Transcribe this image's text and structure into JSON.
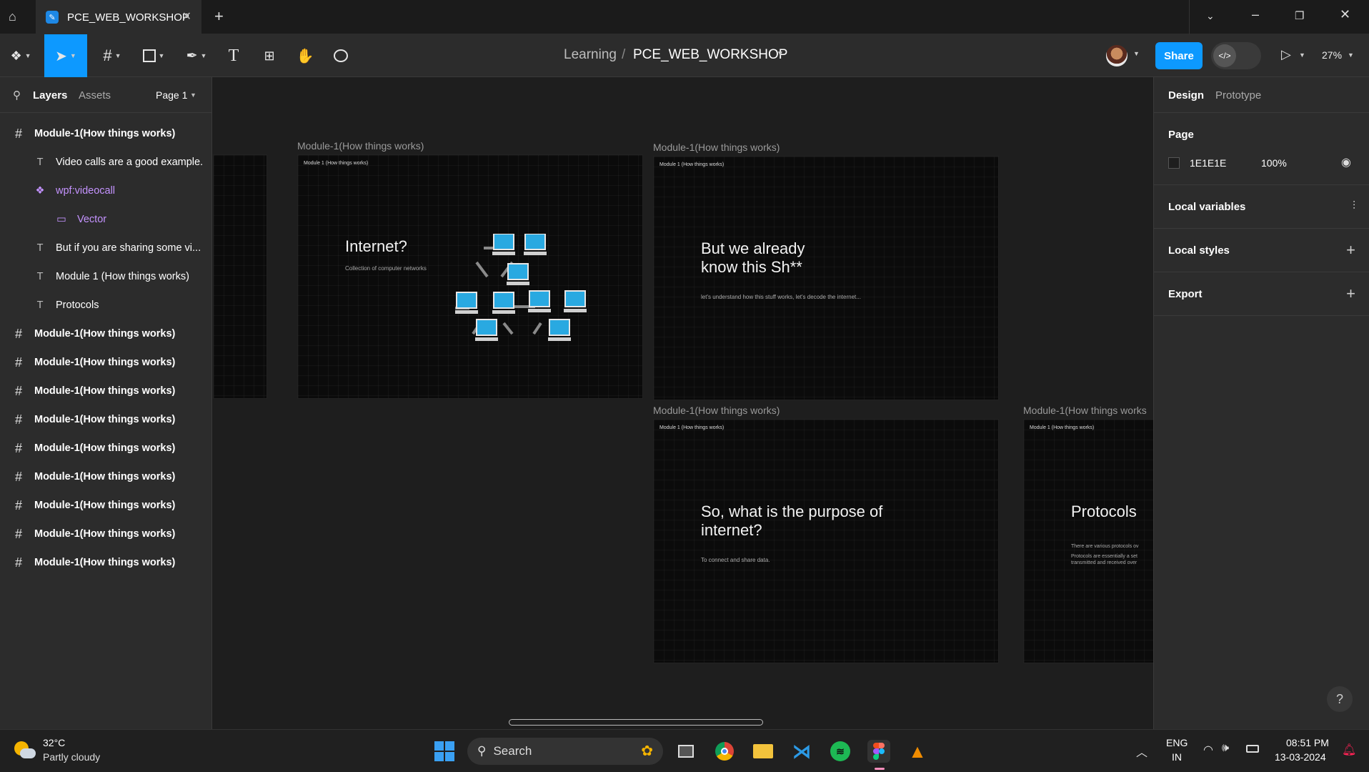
{
  "tab": {
    "title": "PCE_WEB_WORKSHOP"
  },
  "breadcrumb": {
    "team": "Learning",
    "sep": "/",
    "file": "PCE_WEB_WORKSHOP"
  },
  "toolbar": {
    "share": "Share",
    "zoom": "27%"
  },
  "left_panel": {
    "tabs": [
      "Layers",
      "Assets"
    ],
    "page": "Page 1",
    "layers": [
      {
        "label": "Module-1(How things works)",
        "kind": "frame",
        "indent": 0
      },
      {
        "label": "Video calls are a good example.",
        "kind": "text",
        "indent": 1
      },
      {
        "label": "wpf:videocall",
        "kind": "component",
        "indent": 1
      },
      {
        "label": "Vector",
        "kind": "vector",
        "indent": 2
      },
      {
        "label": "But if you are sharing some vi...",
        "kind": "text",
        "indent": 1
      },
      {
        "label": "Module 1 (How things works)",
        "kind": "text",
        "indent": 1
      },
      {
        "label": "Protocols",
        "kind": "text",
        "indent": 1
      },
      {
        "label": "Module-1(How things works)",
        "kind": "frame",
        "indent": 0
      },
      {
        "label": "Module-1(How things works)",
        "kind": "frame",
        "indent": 0
      },
      {
        "label": "Module-1(How things works)",
        "kind": "frame",
        "indent": 0
      },
      {
        "label": "Module-1(How things works)",
        "kind": "frame",
        "indent": 0
      },
      {
        "label": "Module-1(How things works)",
        "kind": "frame",
        "indent": 0
      },
      {
        "label": "Module-1(How things works)",
        "kind": "frame",
        "indent": 0
      },
      {
        "label": "Module-1(How things works)",
        "kind": "frame",
        "indent": 0
      },
      {
        "label": "Module-1(How things works)",
        "kind": "frame",
        "indent": 0
      },
      {
        "label": "Module-1(How things works)",
        "kind": "frame",
        "indent": 0
      }
    ]
  },
  "right_panel": {
    "tabs": [
      "Design",
      "Prototype"
    ],
    "page_title": "Page",
    "page_color": "1E1E1E",
    "page_opacity": "100%",
    "sections": [
      "Local variables",
      "Local styles",
      "Export"
    ]
  },
  "canvas": {
    "frame_label": "Module-1(How things works)",
    "frame_tag": "Module 1 (How things works)",
    "frames": {
      "internet": {
        "title": "Internet?",
        "sub": "Collection of computer networks"
      },
      "know": {
        "title1": "But we already",
        "title2": "know this Sh**",
        "sub": "let's understand how this stuff works, let's decode the internet..."
      },
      "purpose": {
        "title1": "So, what is the purpose of",
        "title2": "internet?",
        "sub": "To connect and share data."
      },
      "protocols": {
        "title": "Protocols",
        "sub1": "There are various protocols ov",
        "sub2": "Protocols are essentially a set",
        "sub3": "transmitted and received over"
      }
    },
    "label_cut": "Module-1(How things works"
  },
  "taskbar": {
    "temp": "32°C",
    "weather": "Partly cloudy",
    "search": "Search",
    "lang1": "ENG",
    "lang2": "IN",
    "time": "08:51 PM",
    "date": "13-03-2024"
  },
  "colors": {
    "accent": "#0d99ff",
    "component": "#c493ff",
    "monitor": "#29a9e1"
  }
}
